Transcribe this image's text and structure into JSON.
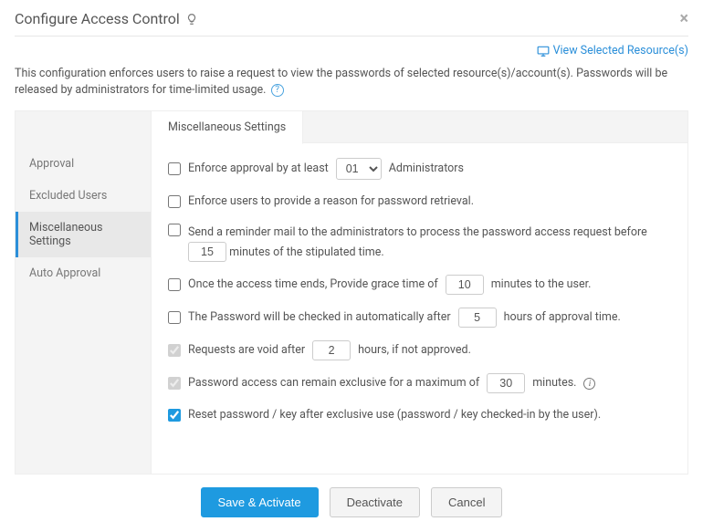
{
  "header": {
    "title": "Configure Access Control"
  },
  "top_link": "View Selected Resource(s)",
  "description": "This configuration enforces users to raise a request to view the passwords of selected resource(s)/account(s). Passwords will be released by administrators for time-limited usage.",
  "sidebar": {
    "items": [
      {
        "label": "Approval"
      },
      {
        "label": "Excluded Users"
      },
      {
        "label": "Miscellaneous Settings"
      },
      {
        "label": "Auto Approval"
      }
    ]
  },
  "tab": {
    "label": "Miscellaneous Settings"
  },
  "settings": {
    "r1a": "Enforce approval by at least",
    "r1_sel": "01",
    "r1b": "Administrators",
    "r2": "Enforce users to provide a reason for password retrieval.",
    "r3a": "Send a reminder mail to the administrators to process the password access request before",
    "r3_val": "15",
    "r3b": "minutes of the stipulated time.",
    "r4a": "Once the access time ends, Provide grace time of",
    "r4_val": "10",
    "r4b": "minutes to the user.",
    "r5a": "The Password will be checked in automatically after",
    "r5_val": "5",
    "r5b": "hours of approval time.",
    "r6a": "Requests are void after",
    "r6_val": "2",
    "r6b": "hours, if not approved.",
    "r7a": "Password access can remain exclusive for a maximum of",
    "r7_val": "30",
    "r7b": "minutes.",
    "r8": "Reset password / key after exclusive use (password / key checked-in by the user)."
  },
  "footer": {
    "save": "Save & Activate",
    "deactivate": "Deactivate",
    "cancel": "Cancel"
  }
}
